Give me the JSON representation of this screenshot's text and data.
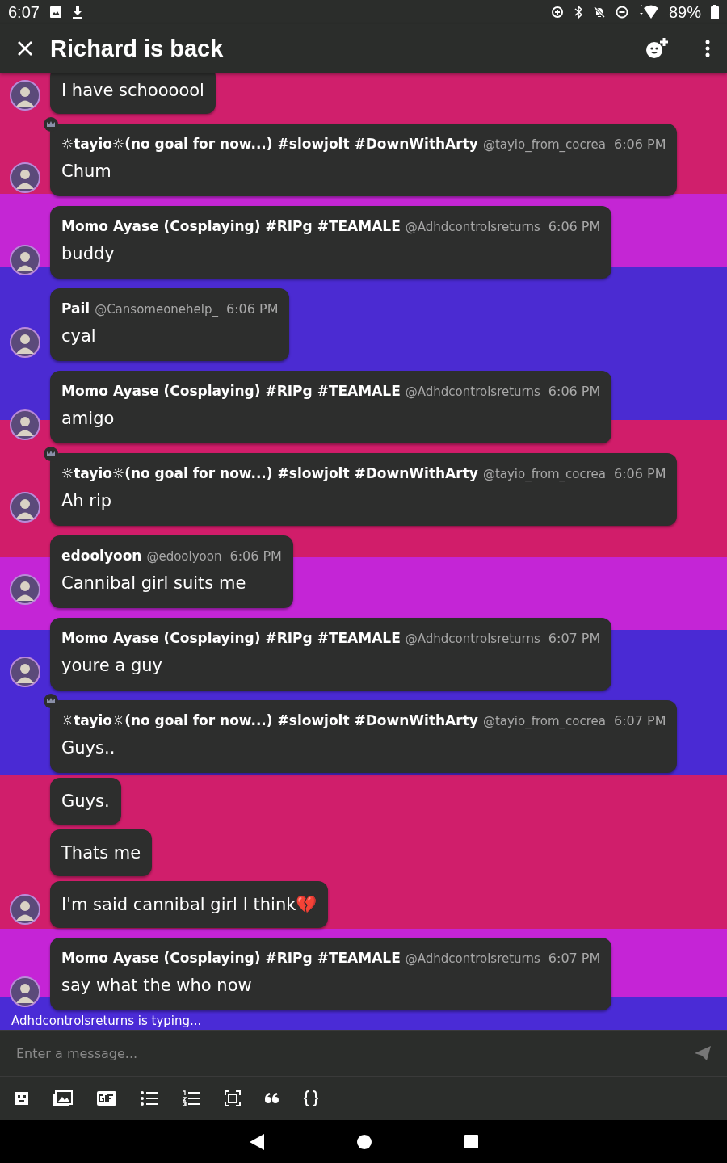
{
  "status_bar": {
    "time": "6:07",
    "battery": "89%"
  },
  "app_bar": {
    "title": "Richard is back"
  },
  "groups": [
    {
      "crown": false,
      "messages": [
        "I have schoooool"
      ]
    },
    {
      "crown": true,
      "name": "☼tayio☼(no goal for now...) #slowjolt #DownWithArty",
      "handle": "@tayio_from_cocrea",
      "time": "6:06 PM",
      "messages": [
        "Chum"
      ]
    },
    {
      "crown": false,
      "name": "Momo Ayase (Cosplaying) #RIPg #TEAMALE",
      "handle": "@Adhdcontrolsreturns",
      "time": "6:06 PM",
      "messages": [
        "buddy"
      ]
    },
    {
      "crown": false,
      "name": "Pail",
      "handle": "@Cansomeonehelp_",
      "time": "6:06 PM",
      "messages": [
        "cyal"
      ]
    },
    {
      "crown": false,
      "name": "Momo Ayase (Cosplaying) #RIPg #TEAMALE",
      "handle": "@Adhdcontrolsreturns",
      "time": "6:06 PM",
      "messages": [
        "amigo"
      ]
    },
    {
      "crown": true,
      "name": "☼tayio☼(no goal for now...) #slowjolt #DownWithArty",
      "handle": "@tayio_from_cocrea",
      "time": "6:06 PM",
      "messages": [
        "Ah rip"
      ]
    },
    {
      "crown": false,
      "name": "edoolyoon",
      "handle": "@edoolyoon",
      "time": "6:06 PM",
      "messages": [
        "Cannibal girl suits me"
      ]
    },
    {
      "crown": false,
      "name": "Momo Ayase (Cosplaying) #RIPg #TEAMALE",
      "handle": "@Adhdcontrolsreturns",
      "time": "6:07 PM",
      "messages": [
        "youre a guy"
      ]
    },
    {
      "crown": true,
      "name": "☼tayio☼(no goal for now...) #slowjolt #DownWithArty",
      "handle": "@tayio_from_cocrea",
      "time": "6:07 PM",
      "messages": [
        "Guys..",
        "Guys.",
        "Thats me",
        "I'm said cannibal girl I think💔"
      ]
    },
    {
      "crown": false,
      "name": "Momo Ayase (Cosplaying) #RIPg #TEAMALE",
      "handle": "@Adhdcontrolsreturns",
      "time": "6:07 PM",
      "messages": [
        "say what the who now"
      ]
    }
  ],
  "typing": "Adhdcontrolsreturns is typing...",
  "composer": {
    "placeholder": "Enter a message..."
  }
}
